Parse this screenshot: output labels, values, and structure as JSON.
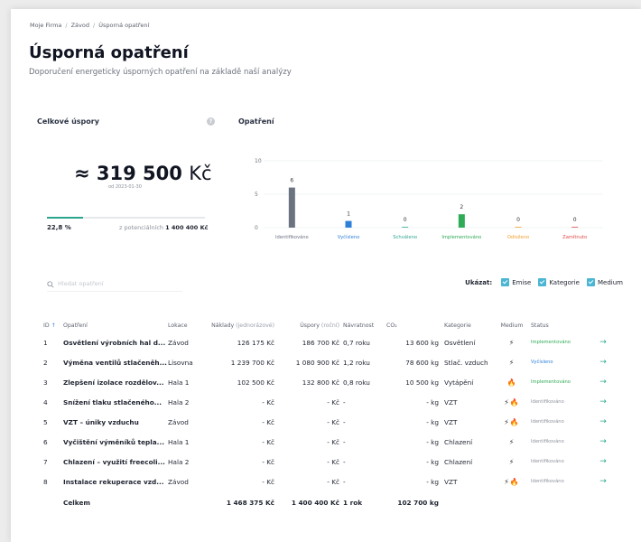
{
  "breadcrumb": [
    "Moje Firma",
    "Závod",
    "Úsporná opatření"
  ],
  "page": {
    "title": "Úsporná opatření",
    "subtitle": "Doporučení energeticky úsporných opatření na základě naší analýzy"
  },
  "savings_card": {
    "title": "Celkové úspory",
    "help_icon": "question-icon",
    "amount": "≈ 319 500",
    "currency": "Kč",
    "since": "od 2023-01-30",
    "progress_fraction": 0.228,
    "percent": "22,8 %",
    "potential_prefix": "z potenciálních",
    "potential_value": "1 400 400 Kč"
  },
  "measures_card": {
    "title": "Opatření"
  },
  "chart_data": {
    "type": "bar",
    "categories": [
      "Identifikováno",
      "Vyčísleno",
      "Schváleno",
      "Implementováno",
      "Odloženo",
      "Zamítnuto"
    ],
    "values": [
      6,
      1,
      0,
      2,
      0,
      0
    ],
    "ylim": [
      0,
      10
    ],
    "yticks": [
      0,
      5,
      10
    ],
    "colors": [
      "#6b7280",
      "#2d7fd8",
      "#2ca58d",
      "#2faa57",
      "#f0a030",
      "#e04848"
    ],
    "grid": true
  },
  "search": {
    "placeholder": "Hledat opatření",
    "icon": "search-icon"
  },
  "show": {
    "label": "Ukázat:",
    "options": [
      "Emise",
      "Kategorie",
      "Medium"
    ]
  },
  "table": {
    "headers": {
      "id": "ID",
      "name": "Opatření",
      "location": "Lokace",
      "costs": "Náklady",
      "costs_sub": "(jednorázové)",
      "savings": "Úspory",
      "savings_sub": "(roční)",
      "payback": "Návratnost",
      "co2": "CO₂",
      "category": "Kategorie",
      "medium": "Medium",
      "status": "Status"
    },
    "rows": [
      {
        "id": "1",
        "name": "Osvětlení výrobních hal d...",
        "location": "Závod",
        "costs": "126 175 Kč",
        "savings": "186 700 Kč",
        "payback": "0,7 roku",
        "co2": "13 600 kg",
        "category": "Osvětlení",
        "medium": "⚡",
        "status": "Implementováno",
        "status_class": "st-impl"
      },
      {
        "id": "2",
        "name": "Výměna ventilů stlačeněh...",
        "location": "Lisovna",
        "costs": "1 239 700 Kč",
        "savings": "1 080 900 Kč",
        "payback": "1,2 roku",
        "co2": "78 600 kg",
        "category": "Stlač. vzduch",
        "medium": "⚡",
        "status": "Vyčísleno",
        "status_class": "st-vy"
      },
      {
        "id": "3",
        "name": "Zlepšení izolace rozdělov...",
        "location": "Hala 1",
        "costs": "102 500 Kč",
        "savings": "132 800 Kč",
        "payback": "0,8 roku",
        "co2": "10 500 kg",
        "category": "Vytápění",
        "medium": "🔥",
        "status": "Implementováno",
        "status_class": "st-impl"
      },
      {
        "id": "4",
        "name": "Snížení tlaku stlačeného...",
        "location": "Hala 2",
        "costs": "- Kč",
        "savings": "- Kč",
        "payback": "-",
        "co2": "- kg",
        "category": "VZT",
        "medium": "⚡🔥",
        "status": "Identifikováno",
        "status_class": "st-id"
      },
      {
        "id": "5",
        "name": "VZT – úniky vzduchu",
        "location": "Závod",
        "costs": "- Kč",
        "savings": "- Kč",
        "payback": "-",
        "co2": "- kg",
        "category": "VZT",
        "medium": "⚡🔥",
        "status": "Identifikováno",
        "status_class": "st-id"
      },
      {
        "id": "6",
        "name": "Vyčištění výměníků tepla...",
        "location": "Hala 1",
        "costs": "- Kč",
        "savings": "- Kč",
        "payback": "-",
        "co2": "- kg",
        "category": "Chlazení",
        "medium": "⚡",
        "status": "Identifikováno",
        "status_class": "st-id"
      },
      {
        "id": "7",
        "name": "Chlazení – využití freecoli...",
        "location": "Hala 2",
        "costs": "- Kč",
        "savings": "- Kč",
        "payback": "-",
        "co2": "- kg",
        "category": "Chlazení",
        "medium": "⚡",
        "status": "Identifikováno",
        "status_class": "st-id"
      },
      {
        "id": "8",
        "name": "Instalace rekuperace vzd...",
        "location": "Závod",
        "costs": "- Kč",
        "savings": "- Kč",
        "payback": "-",
        "co2": "- kg",
        "category": "VZT",
        "medium": "⚡🔥",
        "status": "Identifikováno",
        "status_class": "st-id"
      }
    ],
    "total": {
      "label": "Celkem",
      "costs": "1 468 375 Kč",
      "savings": "1 400 400 Kč",
      "payback": "1 rok",
      "co2": "102 700 kg"
    },
    "row_action_icon": "arrow-right-icon"
  }
}
